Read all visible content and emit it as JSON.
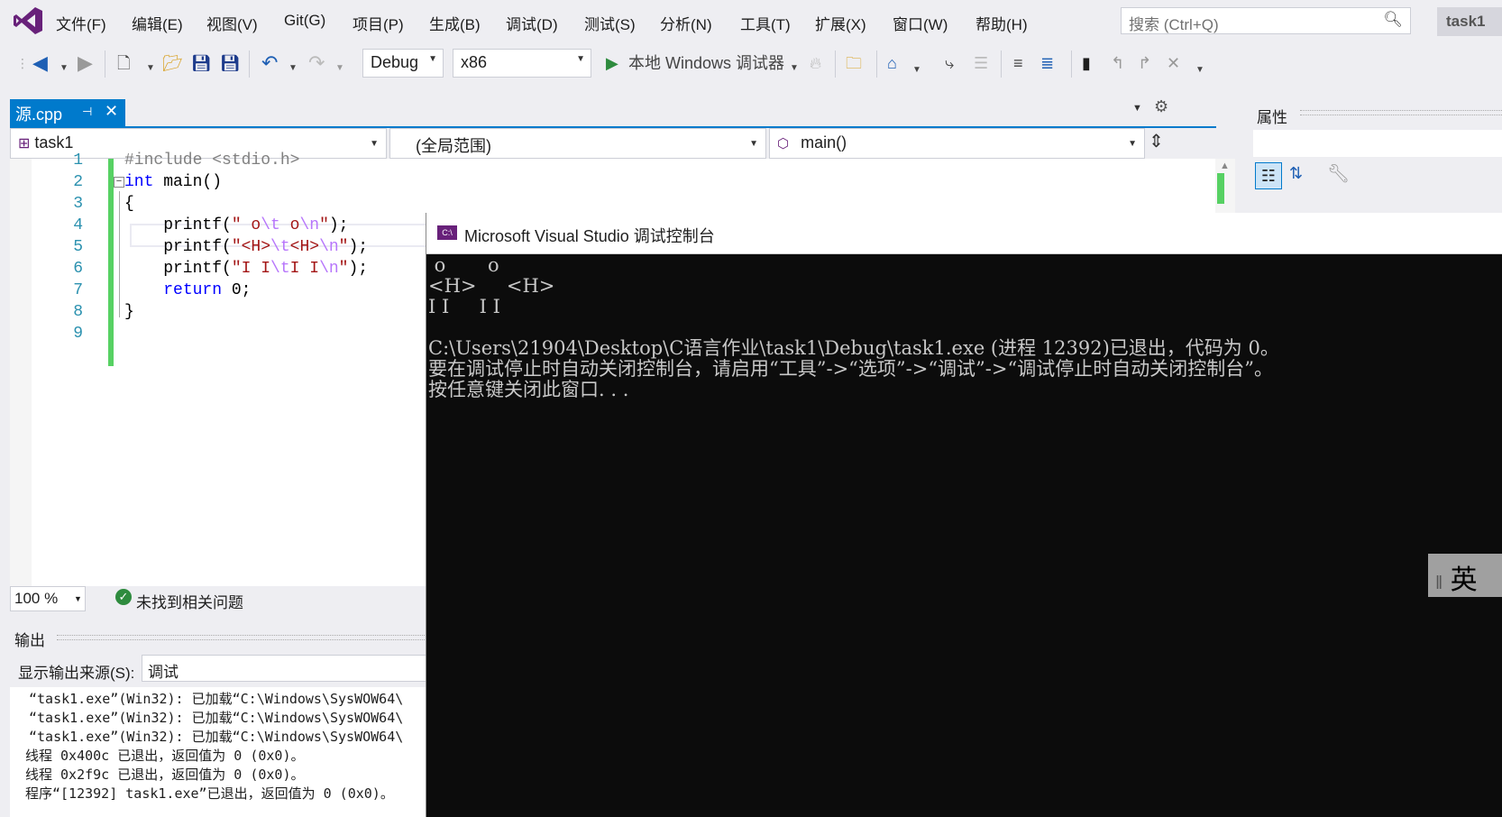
{
  "menu": {
    "items": [
      "文件(F)",
      "编辑(E)",
      "视图(V)",
      "Git(G)",
      "项目(P)",
      "生成(B)",
      "调试(D)",
      "测试(S)",
      "分析(N)",
      "工具(T)",
      "扩展(X)",
      "窗口(W)",
      "帮助(H)"
    ],
    "search_placeholder": "搜索 (Ctrl+Q)",
    "project_title": "task1"
  },
  "toolbar": {
    "config": "Debug",
    "platform": "x86",
    "run_label": "本地 Windows 调试器"
  },
  "editor": {
    "tab_label": "源.cpp",
    "nav_project": "task1",
    "nav_scope": "(全局范围)",
    "nav_member": "main()",
    "line_numbers": [
      "1",
      "2",
      "3",
      "4",
      "5",
      "6",
      "7",
      "8",
      "9"
    ],
    "code_lines": [
      "#include <stdio.h>",
      "int main()",
      "{",
      "    printf(\" o\\t o\\n\");",
      "    printf(\"<H>\\t<H>\\n\");",
      "    printf(\"I I\\tI I\\n\");",
      "    return 0;",
      "}",
      ""
    ],
    "zoom": "100 %",
    "status_text": "未找到相关问题"
  },
  "output": {
    "title": "输出",
    "source_label": "显示输出来源(S):",
    "source_value": "调试",
    "lines": [
      "“task1.exe”(Win32): 已加载“C:\\Windows\\SysWOW64\\",
      "“task1.exe”(Win32): 已加载“C:\\Windows\\SysWOW64\\",
      "“task1.exe”(Win32): 已加载“C:\\Windows\\SysWOW64\\",
      "线程 0x400c 已退出，返回值为 0 (0x0)。",
      "线程 0x2f9c 已退出，返回值为 0 (0x0)。",
      "程序“[12392] task1.exe”已退出，返回值为 0 (0x0)。"
    ]
  },
  "properties": {
    "title": "属性"
  },
  "console": {
    "title": "Microsoft Visual Studio 调试控制台",
    "lines": [
      " o       o",
      "<H>     <H>",
      "I I     I I",
      "",
      "C:\\Users\\21904\\Desktop\\C语言作业\\task1\\Debug\\task1.exe (进程 12392)已退出，代码为 0。",
      "要在调试停止时自动关闭控制台，请启用“工具”->“选项”->“调试”->“调试停止时自动关闭控制台”。",
      "按任意键关闭此窗口. . ."
    ]
  },
  "ime": {
    "label": "英"
  },
  "colors": {
    "accent": "#007acc",
    "console_bg": "#0c0c0c",
    "change_bar": "#57d163"
  }
}
